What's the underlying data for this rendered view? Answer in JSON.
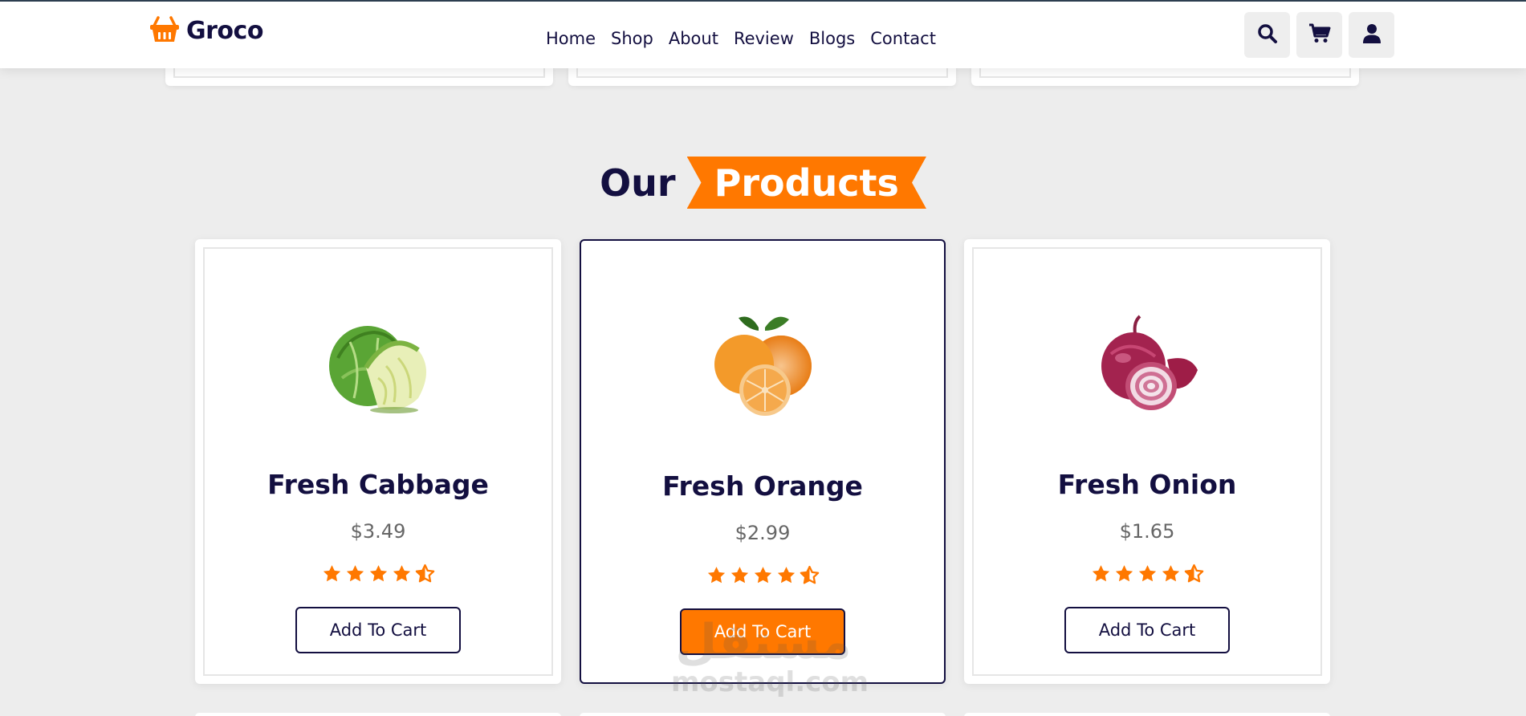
{
  "header": {
    "logo_text": "Groco",
    "nav": [
      "Home",
      "Shop",
      "About",
      "Review",
      "Blogs",
      "Contact"
    ],
    "icons": [
      "search-icon",
      "cart-icon",
      "user-icon"
    ]
  },
  "section": {
    "heading_plain": "Our",
    "heading_highlight": "Products"
  },
  "products": [
    {
      "name": "Fresh Cabbage",
      "price": "$3.49",
      "rating": 4.5,
      "button": "Add To Cart"
    },
    {
      "name": "Fresh Orange",
      "price": "$2.99",
      "rating": 4.5,
      "button": "Add To Cart"
    },
    {
      "name": "Fresh Onion",
      "price": "$1.65",
      "rating": 4.5,
      "button": "Add To Cart"
    }
  ],
  "watermark": {
    "arabic": "مستقل",
    "latin": "mostaql.com"
  },
  "colors": {
    "accent": "#ff7800",
    "dark": "#130f40",
    "background": "#ededed",
    "price": "#666666"
  }
}
